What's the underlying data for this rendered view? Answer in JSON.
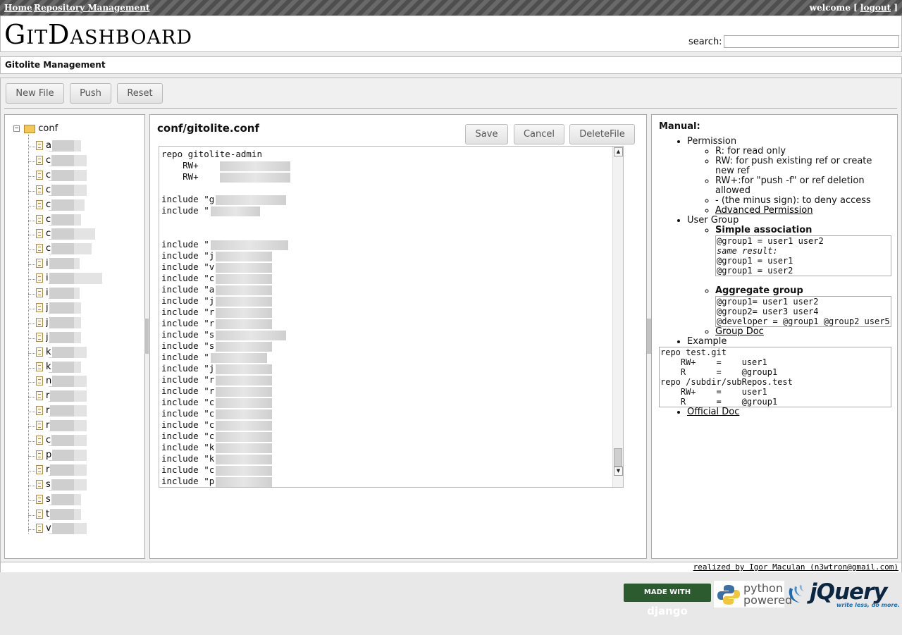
{
  "topnav": {
    "home": "Home",
    "repo_mgmt": "Repository Management",
    "welcome_prefix": "welcome [",
    "logout": "logout",
    "welcome_suffix": "]"
  },
  "header": {
    "logo": "GitDashboard",
    "search_label": "search:",
    "search_value": ""
  },
  "section": {
    "title": "Gitolite Management"
  },
  "toolbar": {
    "new_file": "New File",
    "push": "Push",
    "reset": "Reset"
  },
  "tree": {
    "root_label": "conf",
    "files": [
      "a",
      "c",
      "c",
      "c",
      "c",
      "c",
      "c",
      "c",
      "i",
      "i",
      "i",
      "j",
      "j",
      "j",
      "k",
      "k",
      "n",
      "r",
      "r",
      "r",
      "c",
      "p",
      "r",
      "s",
      "s",
      "t",
      "v"
    ]
  },
  "editor": {
    "title": "conf/gitolite.conf",
    "save": "Save",
    "cancel": "Cancel",
    "delete": "DeleteFile",
    "lines": [
      "repo gitolite-admin",
      "    RW+",
      "    RW+",
      "",
      "include \"g",
      "include \"",
      "",
      "",
      "include \"",
      "include \"j",
      "include \"v",
      "include \"c",
      "include \"a",
      "include \"j",
      "include \"r",
      "include \"r",
      "include \"s",
      "include \"s",
      "include \"",
      "include \"j",
      "include \"r",
      "include \"r",
      "include \"c",
      "include \"c",
      "include \"c",
      "include \"c",
      "include \"k",
      "include \"k",
      "include \"c",
      "include \"p"
    ]
  },
  "manual": {
    "title": "Manual:",
    "permission": "Permission",
    "perm_items": [
      "R: for read only",
      "RW: for push existing ref or create new ref",
      "RW+:for \"push -f\" or ref deletion allowed",
      "- (the minus sign): to deny access"
    ],
    "advanced_link": "Advanced Permission",
    "user_group": "User Group",
    "simple_assoc": "Simple association",
    "simple_code_1": "@group1 = user1 user2",
    "simple_code_2": "same result:",
    "simple_code_3": "@group1 = user1\n@group1 = user2",
    "aggregate": "Aggregate group",
    "aggregate_code": "@group1= user1 user2\n@group2= user3 user4\n@developer = @group1 @group2 user5",
    "group_doc": "Group Doc",
    "example": "Example",
    "example_code": "repo test.git\n    RW+    =    user1\n    R      =    @group1\nrepo /subdir/subRepos.test\n    RW+    =    user1\n    R      =    @group1",
    "official_doc": "Official Doc"
  },
  "footer": {
    "credit": "realized by Igor Maculan (n3wtron@gmail.com)"
  },
  "badges": {
    "django_prefix": "MADE WITH",
    "django": "django",
    "python_1": "python",
    "python_2": "powered",
    "jquery": "jQuery",
    "jquery_tag": "write less, do more."
  }
}
